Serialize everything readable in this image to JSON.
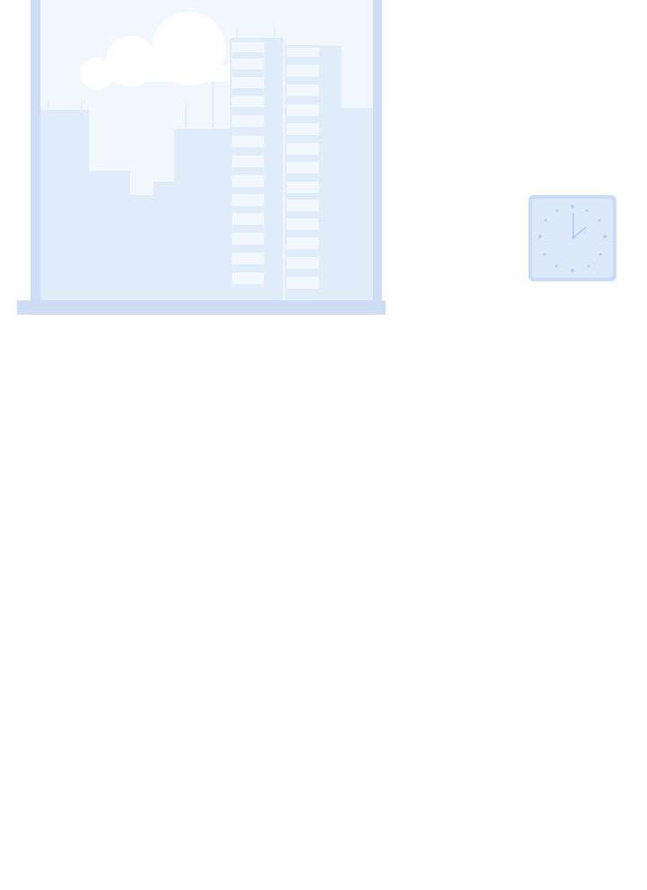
{
  "scene": {
    "background": "#fefefe"
  },
  "window": {
    "icon": "window-cityscape-illustration",
    "frame_color": "#cdddf6",
    "glass_color": "#f1f7fd",
    "building_color": "#e1ecfb",
    "window_pane_color": "#f1f7fd",
    "cloud_color": "#ffffff"
  },
  "clock": {
    "icon": "square-wall-clock-icon",
    "frame_color": "#c8dcf6",
    "face_color": "#dce9fb",
    "hand_color": "#a9c6ef",
    "time_shown": "2:00"
  }
}
